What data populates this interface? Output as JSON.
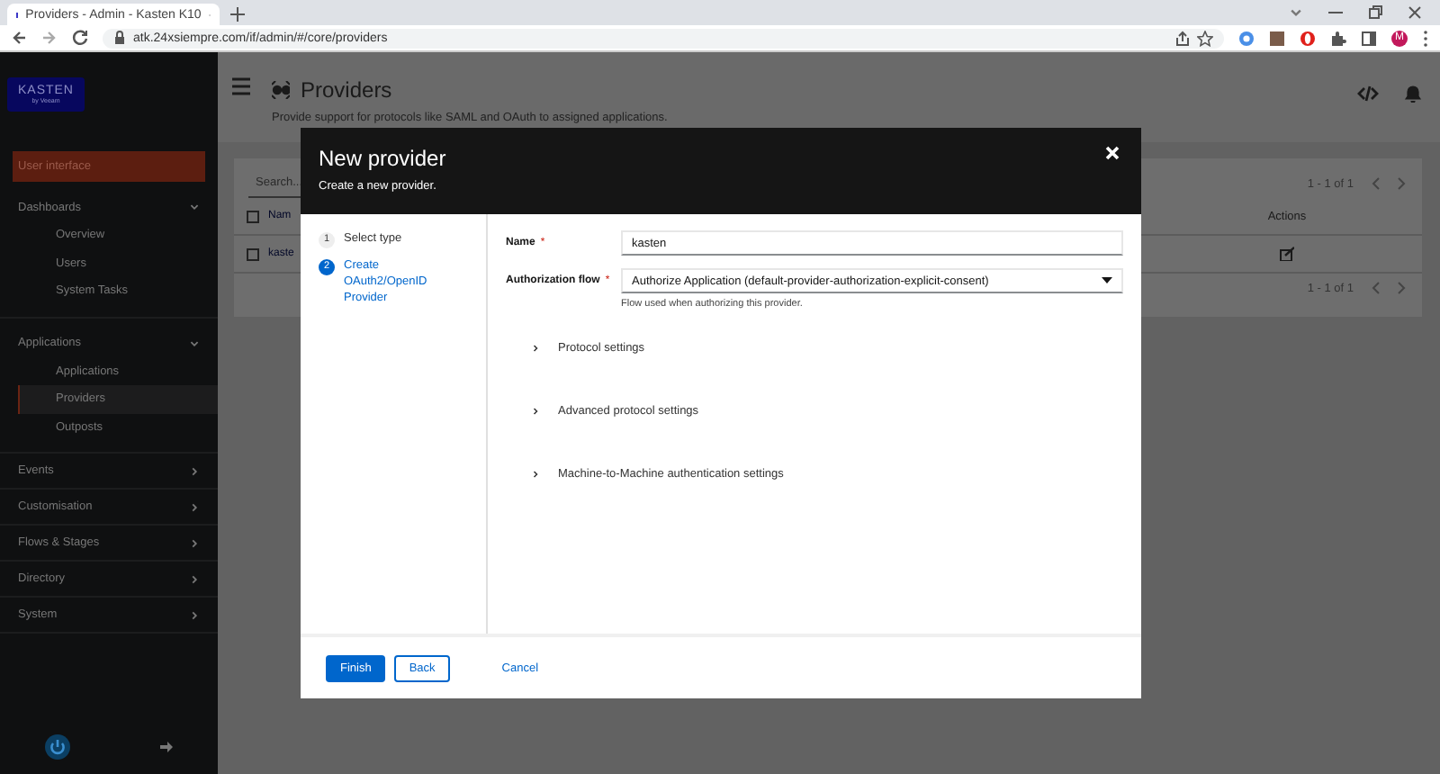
{
  "browser": {
    "tab_title": "Providers - Admin - Kasten K10",
    "url": "atk.24xsiempre.com/if/admin/#/core/providers",
    "profile_initial": "M"
  },
  "sidebar": {
    "logo_text": "KASTEN",
    "logo_subtext": "by Veeam",
    "interface_button": "User interface",
    "sections": [
      {
        "label": "Dashboards",
        "expanded": true,
        "children": [
          {
            "label": "Overview",
            "selected": false
          },
          {
            "label": "Users",
            "selected": false
          },
          {
            "label": "System Tasks",
            "selected": false
          }
        ]
      },
      {
        "label": "Applications",
        "expanded": true,
        "children": [
          {
            "label": "Applications",
            "selected": false
          },
          {
            "label": "Providers",
            "selected": true
          },
          {
            "label": "Outposts",
            "selected": false
          }
        ]
      },
      {
        "label": "Events",
        "expanded": false
      },
      {
        "label": "Customisation",
        "expanded": false
      },
      {
        "label": "Flows & Stages",
        "expanded": false
      },
      {
        "label": "Directory",
        "expanded": false
      },
      {
        "label": "System",
        "expanded": false
      }
    ]
  },
  "page": {
    "title": "Providers",
    "subtitle": "Provide support for protocols like SAML and OAuth to assigned applications.",
    "search": {
      "placeholder": "Search..."
    },
    "pagination_top": "1 - 1 of 1",
    "pagination_bottom": "1 - 1 of 1",
    "table": {
      "select_all_checked": false,
      "columns": [
        "Nam",
        "Actions"
      ],
      "rows": [
        {
          "checked": false,
          "cells": [
            "kaste"
          ]
        }
      ]
    }
  },
  "modal": {
    "title": "New provider",
    "subtitle": "Create a new provider.",
    "steps": [
      {
        "number": "1",
        "label": "Select type",
        "selected": false
      },
      {
        "number": "2",
        "label": "Create OAuth2/OpenID Provider",
        "selected": true
      }
    ],
    "fields": [
      {
        "kind": "text",
        "label": "Name",
        "required_mark": "*",
        "value": "kasten"
      },
      {
        "kind": "select",
        "label": "Authorization flow",
        "required_mark": "*",
        "value": "Authorize Application (default-provider-authorization-explicit-consent)",
        "helper": "Flow used when authorizing this provider."
      }
    ],
    "sections": [
      {
        "label": "Protocol settings",
        "expanded": false
      },
      {
        "label": "Advanced protocol settings",
        "expanded": false
      },
      {
        "label": "Machine-to-Machine authentication settings",
        "expanded": false
      }
    ],
    "buttons": [
      {
        "kind": "primary",
        "label": "Finish"
      },
      {
        "kind": "secondary",
        "label": "Back"
      },
      {
        "kind": "link",
        "label": "Cancel"
      }
    ]
  }
}
